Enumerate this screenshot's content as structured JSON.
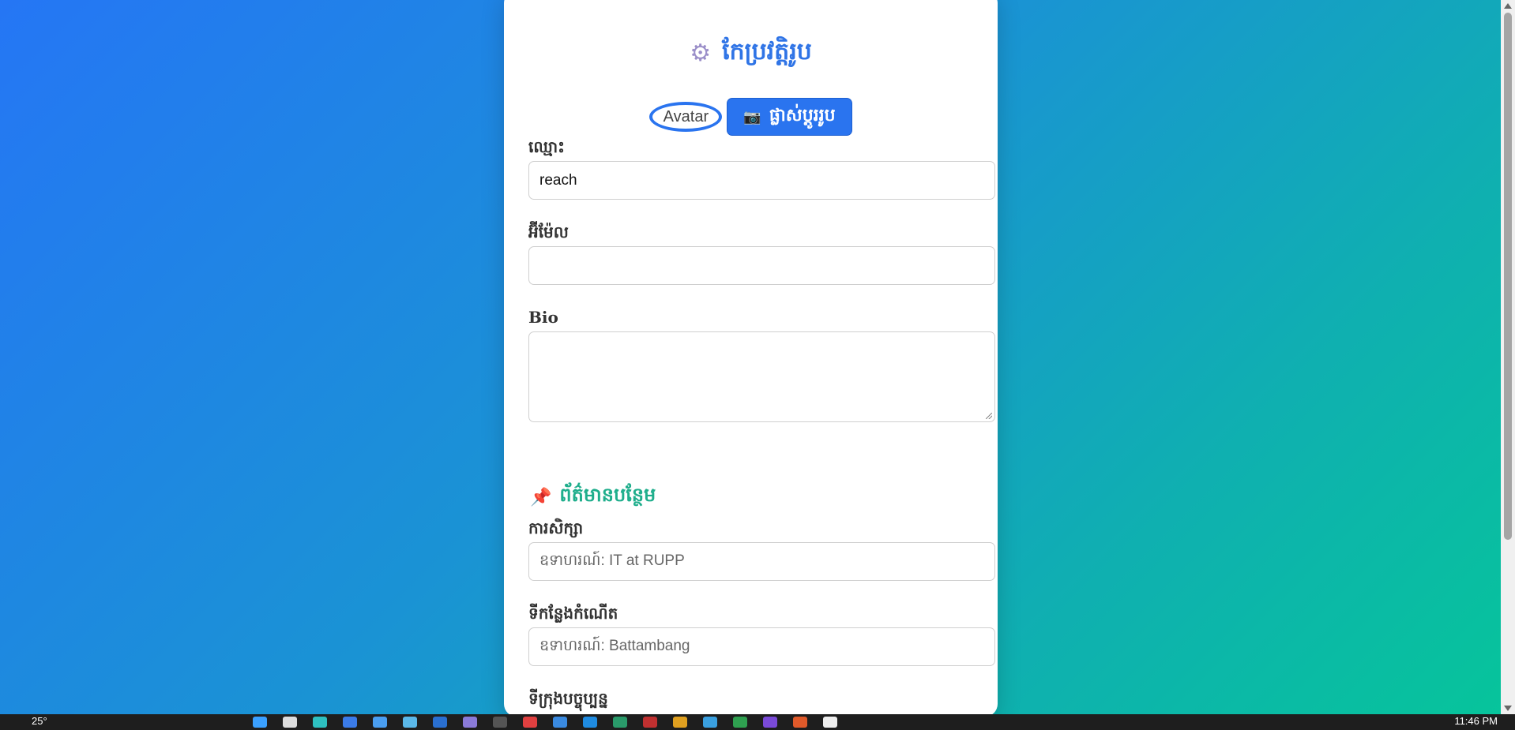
{
  "header": {
    "title": "កែប្រវត្តិរូប",
    "icon": "gear-icon"
  },
  "avatar": {
    "alt_text": "Avatar",
    "change_button_label": "ផ្លាស់ប្តូររូប",
    "change_button_icon": "camera-icon"
  },
  "form": {
    "name": {
      "label": "ឈ្មោះ",
      "value": "reach"
    },
    "email": {
      "label": "អ៊ីម៉ែល",
      "value": ""
    },
    "bio": {
      "label": "Bio",
      "value": ""
    }
  },
  "extra_section": {
    "title": "ព័ត៌មានបន្ថែម",
    "icon": "pin-icon",
    "education": {
      "label": "ការសិក្សា",
      "placeholder": "ឧទាហរណ៍: IT at RUPP"
    },
    "birthplace": {
      "label": "ទីកន្លែងកំណើត",
      "placeholder": "ឧទាហរណ៍: Battambang"
    },
    "current_city": {
      "label": "ទីក្រុងបច្ចុប្បន្ន"
    }
  },
  "taskbar": {
    "weather": "25°",
    "clock": "11:46 PM"
  },
  "colors": {
    "accent": "#2a74ef",
    "section_title": "#1fae8c",
    "gradient_start": "#2576f5",
    "gradient_end": "#06c59a"
  }
}
